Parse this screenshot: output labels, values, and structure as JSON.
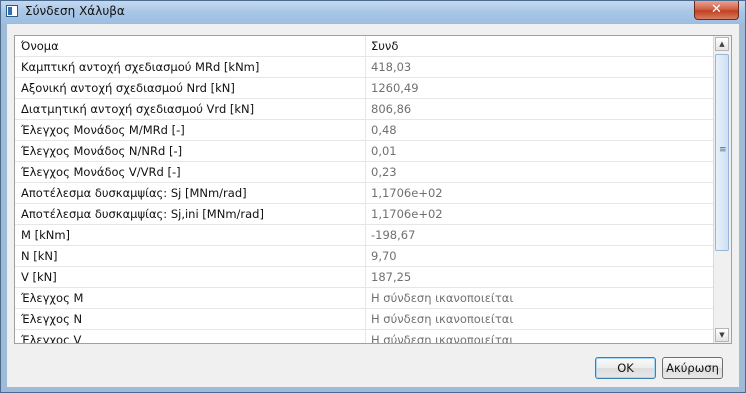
{
  "window": {
    "title": "Σύνδεση Χάλυβα",
    "close_glyph": "✕"
  },
  "grid": {
    "columns": [
      "Όνομα",
      "Συνδ"
    ],
    "rows": [
      [
        "Καμπτική αντοχή σχεδιασμού MRd [kNm]",
        "418,03"
      ],
      [
        "Αξονική αντοχή σχεδιασμού Nrd [kN]",
        "1260,49"
      ],
      [
        "Διατμητική αντοχή σχεδιασμού Vrd [kN]",
        "806,86"
      ],
      [
        "Έλεγχος Μονάδος M/MRd  [-]",
        "0,48"
      ],
      [
        "Έλεγχος Μονάδος N/NRd  [-]",
        "0,01"
      ],
      [
        "Έλεγχος Μονάδος V/VRd  [-]",
        "0,23"
      ],
      [
        "Αποτέλεσμα δυσκαμψίας: Sj [MNm/rad]",
        "1,1706e+02"
      ],
      [
        "Αποτέλεσμα δυσκαμψίας: Sj,ini [MNm/rad]",
        "1,1706e+02"
      ],
      [
        "M [kNm]",
        "-198,67"
      ],
      [
        "N [kN]",
        "9,70"
      ],
      [
        "V [kN]",
        "187,25"
      ],
      [
        "Έλεγχος M",
        "Η σύνδεση ικανοποιείται"
      ],
      [
        "Έλεγχος N",
        "Η σύνδεση ικανοποιείται"
      ],
      [
        "Έλεγχος V",
        "Η σύνδεση ικανοποιείται"
      ]
    ]
  },
  "scrollbar": {
    "up_glyph": "▲",
    "down_glyph": "▼",
    "grip_glyph": "≡"
  },
  "buttons": {
    "ok": "OK",
    "cancel": "Ακύρωση"
  }
}
